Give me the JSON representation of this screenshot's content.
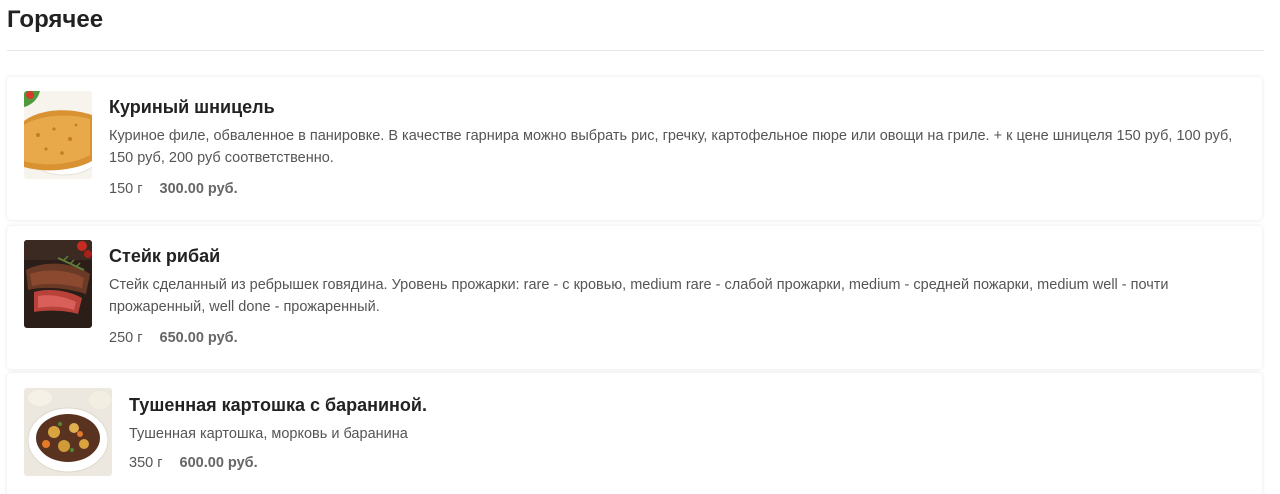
{
  "section": {
    "title": "Горячее"
  },
  "items": [
    {
      "name": "Куриный шницель",
      "description": "Куриное филе, обваленное в панировке. В качестве гарнира можно выбрать рис, гречку, картофельное пюре или овощи на гриле. + к цене шницеля 150 руб, 100 руб, 150 руб, 200 руб соответственно.",
      "weight": "150 г",
      "price": "300.00 руб.",
      "image_icon": "schnitzel-image"
    },
    {
      "name": "Стейк рибай",
      "description": "Стейк сделанный из ребрышек говядина. Уровень прожарки: rare - с кровью, medium rare - слабой прожарки, medium - средней пожарки, medium well - почти прожаренный, well done - прожаренный.",
      "weight": "250 г",
      "price": "650.00 руб.",
      "image_icon": "ribeye-steak-image"
    },
    {
      "name": "Тушенная картошка с бараниной.",
      "description": "Тушенная картошка, морковь и баранина",
      "weight": "350 г",
      "price": "600.00 руб.",
      "image_icon": "stewed-potatoes-image"
    }
  ],
  "colors": {
    "title": "#222222",
    "text": "#555555",
    "divider": "#e6e6e6"
  }
}
